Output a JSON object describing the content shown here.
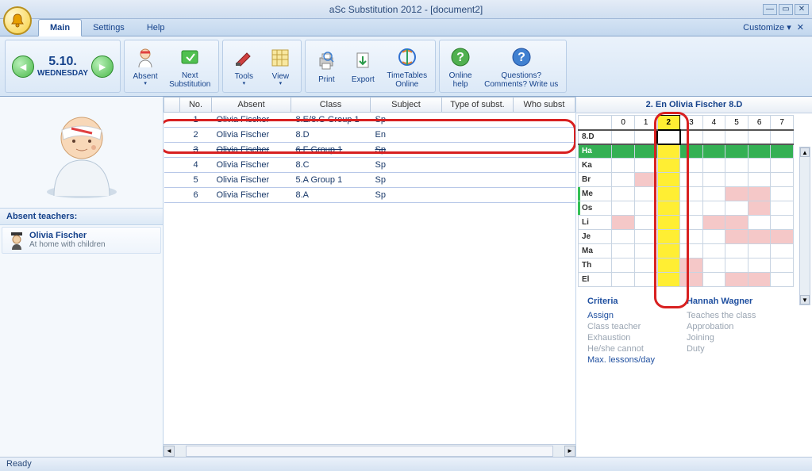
{
  "window": {
    "title": "aSc Substitution 2012  - [document2]",
    "customize": "Customize ▾"
  },
  "menu": {
    "main": "Main",
    "settings": "Settings",
    "help": "Help"
  },
  "date": {
    "day": "5.10.",
    "dow": "WEDNESDAY"
  },
  "ribbon": {
    "absent": "Absent",
    "next_sub": "Next\nSubstitution",
    "tools": "Tools",
    "view": "View",
    "print": "Print",
    "export": "Export",
    "tt_online": "TimeTables\nOnline",
    "online_help": "Online\nhelp",
    "questions": "Questions?\nComments? Write us"
  },
  "sidebar": {
    "absent_header": "Absent teachers:",
    "teacher": {
      "name": "Olivia Fischer",
      "note": "At home with children"
    }
  },
  "grid": {
    "headers": {
      "gap": "",
      "no": "No.",
      "absent": "Absent",
      "class": "Class",
      "subject": "Subject",
      "type": "Type of subst.",
      "who": "Who subst"
    },
    "rows": [
      {
        "no": "1",
        "absent": "Olivia Fischer",
        "class": "8.E/8.G Group 1",
        "subject": "Sp"
      },
      {
        "no": "2",
        "absent": "Olivia Fischer",
        "class": "8.D",
        "subject": "En"
      },
      {
        "no": "3",
        "absent": "Olivia Fischer",
        "class": "6.F Group 1",
        "subject": "Sp"
      },
      {
        "no": "4",
        "absent": "Olivia Fischer",
        "class": "8.C",
        "subject": "Sp"
      },
      {
        "no": "5",
        "absent": "Olivia Fischer",
        "class": "5.A Group 1",
        "subject": "Sp"
      },
      {
        "no": "6",
        "absent": "Olivia Fischer",
        "class": "8.A",
        "subject": "Sp"
      }
    ]
  },
  "rightpanel": {
    "title": "2. En Olivia Fischer 8.D",
    "periods": [
      "0",
      "1",
      "2",
      "3",
      "4",
      "5",
      "6",
      "7"
    ],
    "class_row_label": "8.D",
    "teacher_rows": [
      "Ha",
      "Ka",
      "Br",
      "Me",
      "Os",
      "Li",
      "Je",
      "Ma",
      "Th",
      "El"
    ],
    "criteria_label": "Criteria",
    "teacher_name": "Hannah Wagner",
    "criteria": [
      "Assign",
      "Class teacher",
      "Exhaustion",
      "He/she cannot",
      "Max. lessons/day"
    ],
    "teacher_info": [
      "Teaches the class",
      "Approbation",
      "Joining",
      "Duty"
    ]
  },
  "status": "Ready"
}
